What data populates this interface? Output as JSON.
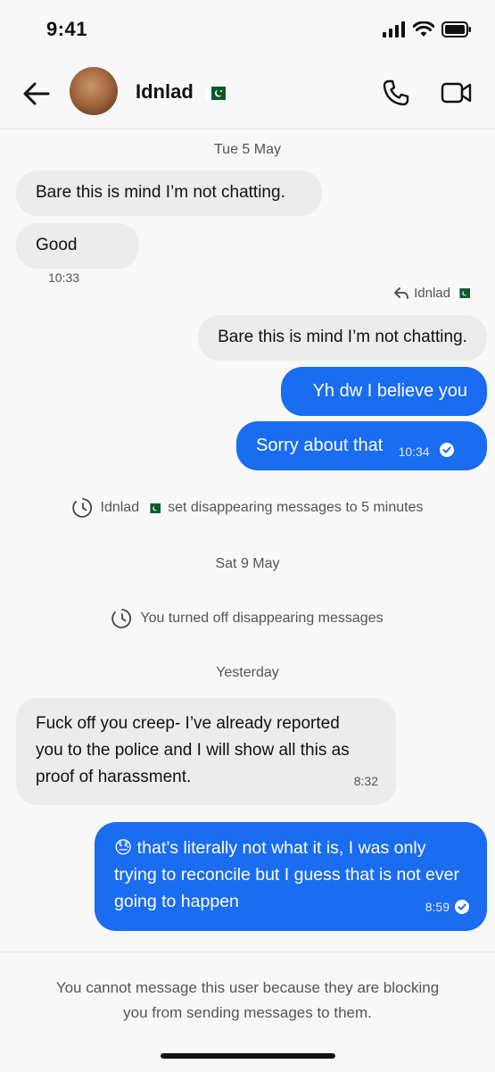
{
  "status": {
    "time": "9:41"
  },
  "header": {
    "name": "Idnlad",
    "flag": "pakistan-flag"
  },
  "dates": {
    "d1": "Tue 5 May",
    "d2": "Sat 9 May",
    "d3": "Yesterday"
  },
  "messages": {
    "m1": {
      "text": "Bare this is mind I’m not chatting."
    },
    "m2": {
      "text": "Good",
      "time": "10:33"
    },
    "reply": {
      "label": "Idnlad",
      "quoted": "Bare this is mind I’m not chatting."
    },
    "m3": {
      "text": "Yh dw I believe you"
    },
    "m4": {
      "text": "Sorry about that",
      "time": "10:34"
    },
    "m5": {
      "text": "Fuck off you creep- I’ve already reported you to the police and I will show all this as proof of harassment.",
      "time": "8:32"
    },
    "m6": {
      "emoji": "😓",
      "text": "that’s literally not what it is, I was only trying to reconcile but I guess that is not ever going to happen",
      "time": "8:59"
    }
  },
  "system": {
    "s1_name": "Idnlad",
    "s1_text": "set disappearing messages to 5 minutes",
    "s2_text": "You turned off disappearing messages"
  },
  "footer": {
    "note": "You cannot message this user because they are blocking you from sending messages to them."
  },
  "colors": {
    "outgoing": "#1a6cf0",
    "incoming": "#ececec",
    "background": "#f8f8f8"
  }
}
